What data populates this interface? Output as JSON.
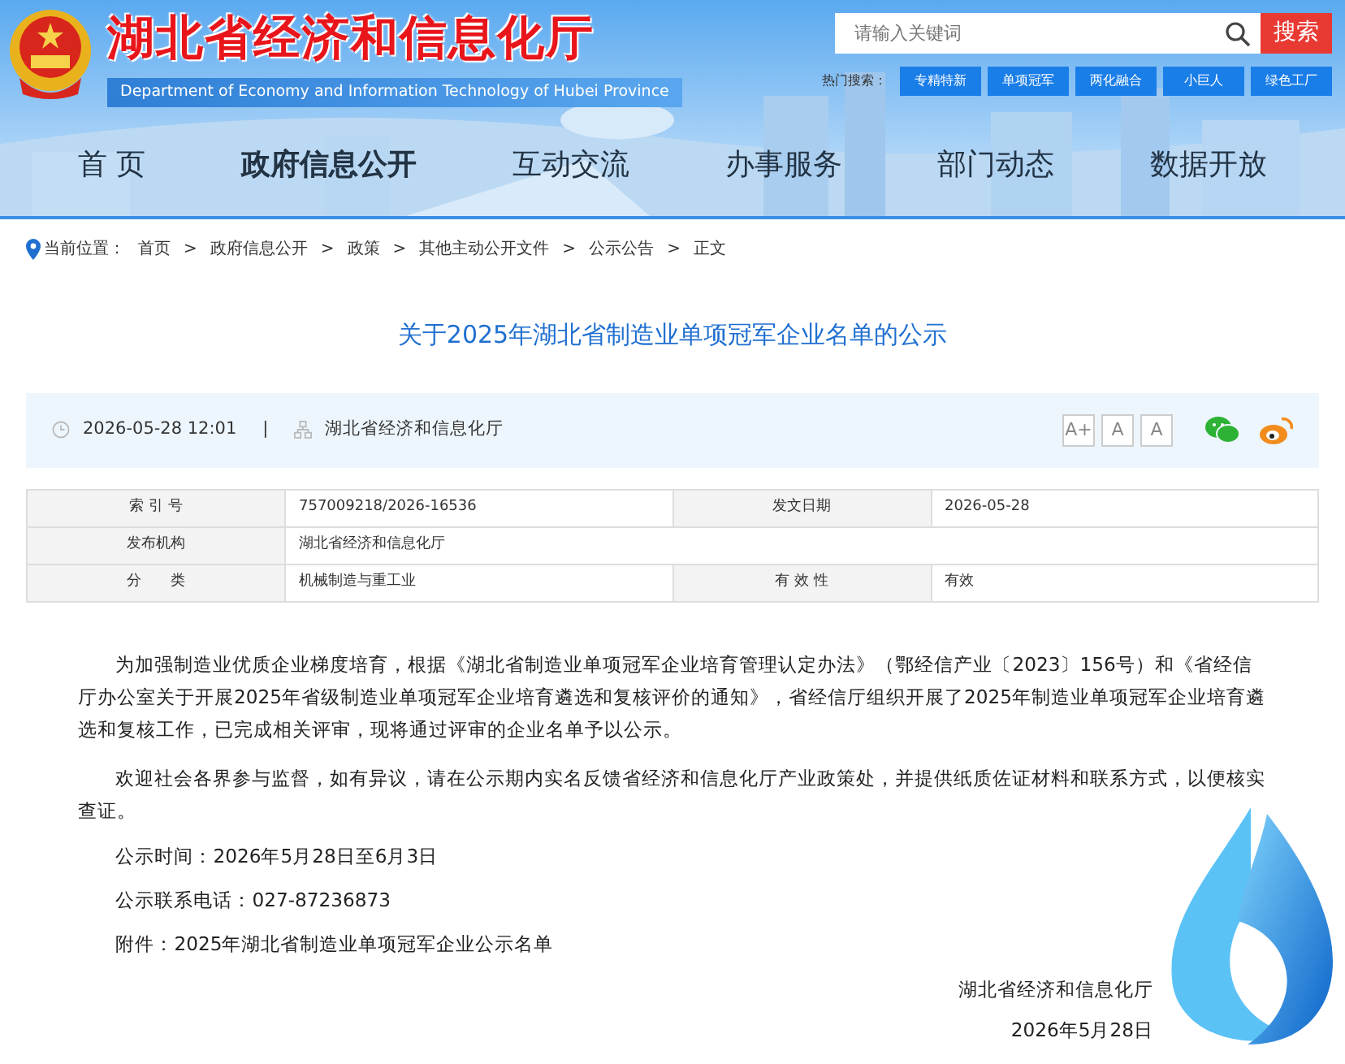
{
  "header": {
    "title": "湖北省经济和信息化厅",
    "subtitle": "Department of Economy and Information Technology of Hubei Province",
    "search": {
      "placeholder": "请输入关键词",
      "button": "搜索"
    },
    "hot_label": "热门搜索：",
    "hot_tags": [
      "专精特新",
      "单项冠军",
      "两化融合",
      "小巨人",
      "绿色工厂"
    ]
  },
  "nav": [
    {
      "label": "首 页",
      "selected": false
    },
    {
      "label": "政府信息公开",
      "selected": true
    },
    {
      "label": "互动交流",
      "selected": false
    },
    {
      "label": "办事服务",
      "selected": false
    },
    {
      "label": "部门动态",
      "selected": false
    },
    {
      "label": "数据开放",
      "selected": false
    }
  ],
  "breadcrumb": {
    "label": "当前位置：",
    "items": [
      "首页",
      "政府信息公开",
      "政策",
      "其他主动公开文件",
      "公示公告",
      "正文"
    ],
    "separator": ">"
  },
  "article": {
    "title": "关于2025年湖北省制造业单项冠军企业名单的公示",
    "datetime": "2026-05-28 12:01",
    "divider": "|",
    "source": "湖北省经济和信息化厅",
    "font_sizes": [
      "A+",
      "A",
      "A"
    ],
    "meta": [
      [
        {
          "label": "索 引 号",
          "value": "757009218/2026-16536"
        },
        {
          "label": "发文日期",
          "value": "2026-05-28"
        }
      ],
      [
        {
          "label": "发布机构",
          "value": "湖北省经济和信息化厅"
        }
      ],
      [
        {
          "label": "分　　类",
          "value": "机械制造与重工业"
        },
        {
          "label": "有 效 性",
          "value": "有效"
        }
      ]
    ],
    "paragraphs": [
      "为加强制造业优质企业梯度培育，根据《湖北省制造业单项冠军企业培育管理认定办法》（鄂经信产业〔2023〕156号）和《省经信厅办公室关于开展2025年省级制造业单项冠军企业培育遴选和复核评价的通知》，省经信厅组织开展了2025年制造业单项冠军企业培育遴选和复核工作，已完成相关评审，现将通过评审的企业名单予以公示。",
      "欢迎社会各界参与监督，如有异议，请在公示期内实名反馈省经济和信息化厅产业政策处，并提供纸质佐证材料和联系方式，以便核实查证。"
    ],
    "lines": [
      "公示时间：2026年5月28日至6月3日",
      "公示联系电话：027-87236873",
      "附件：2025年湖北省制造业单项冠军企业公示名单"
    ],
    "signature": "湖北省经济和信息化厅",
    "date": "2026年5月28日"
  }
}
